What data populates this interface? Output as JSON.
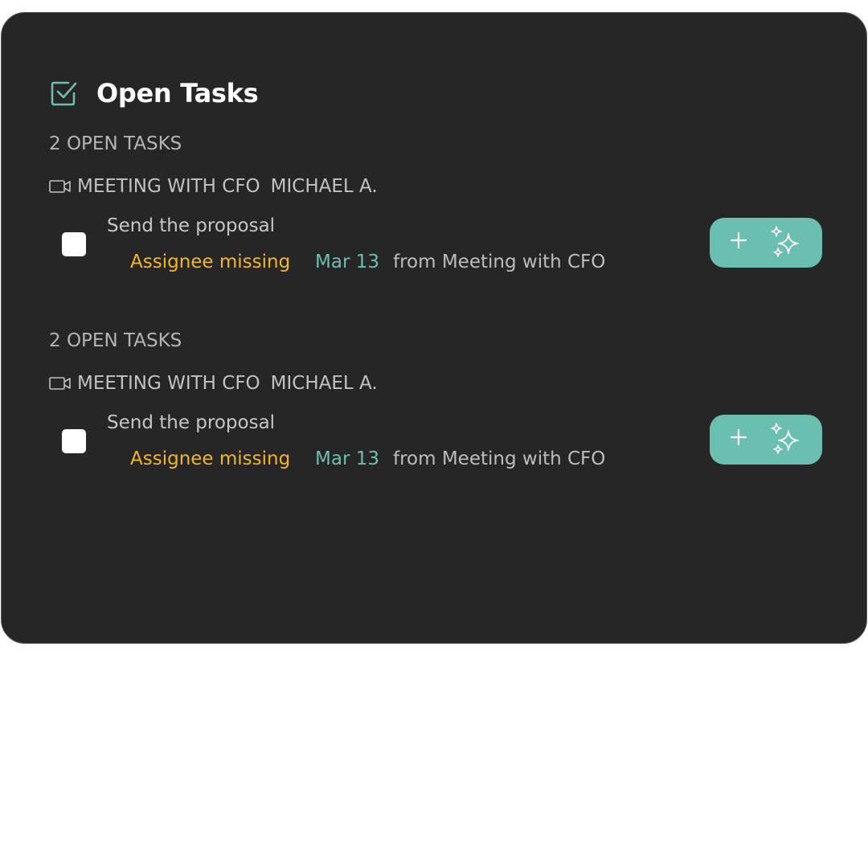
{
  "panel": {
    "title": "Open Tasks",
    "icon": "checkbox-checked-icon"
  },
  "colors": {
    "background": "#262626",
    "accent": "#6bbfb0",
    "warning": "#f2b620"
  },
  "groups": [
    {
      "count_label": "2 OPEN TASKS",
      "meeting_title": "MEETING WITH CFO",
      "meeting_person": "MICHAEL A.",
      "meeting_icon": "video-camera-icon",
      "tasks": [
        {
          "title": "Send the proposal",
          "assignee_status": "Assignee missing",
          "due_date": "Mar 13",
          "source": "from Meeting with CFO",
          "checked": false,
          "actions": [
            "plus-icon",
            "sparkle-icon"
          ]
        }
      ]
    },
    {
      "count_label": "2 OPEN TASKS",
      "meeting_title": "MEETING WITH CFO",
      "meeting_person": "MICHAEL A.",
      "meeting_icon": "video-camera-icon",
      "tasks": [
        {
          "title": "Send the proposal",
          "assignee_status": "Assignee missing",
          "due_date": "Mar 13",
          "source": "from Meeting with CFO",
          "checked": false,
          "actions": [
            "plus-icon",
            "sparkle-icon"
          ]
        }
      ]
    }
  ]
}
